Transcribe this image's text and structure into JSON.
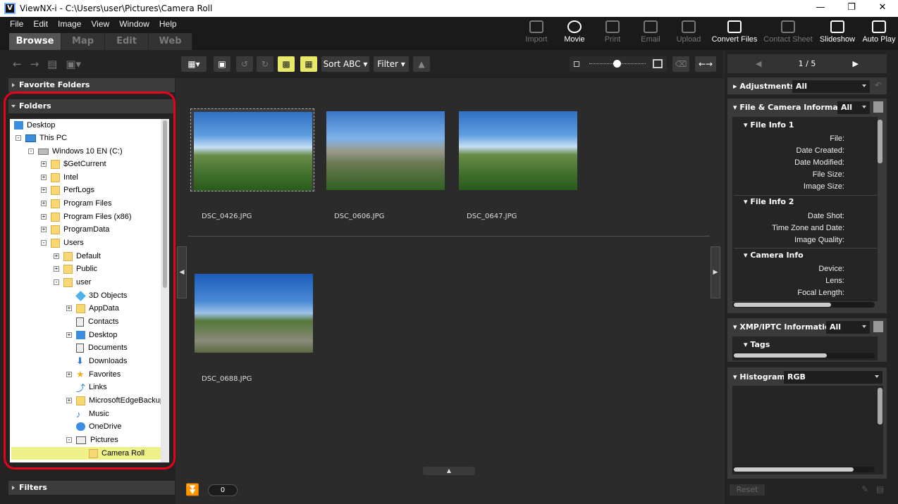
{
  "titlebar": {
    "app_name": "ViewNX-i",
    "path": "C:\\Users\\user\\Pictures\\Camera Roll",
    "logo_text": "V"
  },
  "menu": [
    "File",
    "Edit",
    "Image",
    "View",
    "Window",
    "Help"
  ],
  "mode_tabs": [
    "Browse",
    "Map",
    "Edit",
    "Web"
  ],
  "top_buttons": [
    "Import",
    "Movie",
    "Print",
    "Email",
    "Upload",
    "Convert Files",
    "Contact Sheet",
    "Slideshow",
    "Auto Play"
  ],
  "left": {
    "favorite_folders": "Favorite Folders",
    "folders": "Folders",
    "filters": "Filters",
    "tree": [
      "Desktop",
      "This PC",
      "Windows 10 EN (C:)",
      "$GetCurrent",
      "Intel",
      "PerfLogs",
      "Program Files",
      "Program Files (x86)",
      "ProgramData",
      "Users",
      "Default",
      "Public",
      "user",
      "3D Objects",
      "AppData",
      "Contacts",
      "Desktop",
      "Documents",
      "Downloads",
      "Favorites",
      "Links",
      "MicrosoftEdgeBackup",
      "Music",
      "OneDrive",
      "Pictures",
      "Camera Roll"
    ]
  },
  "center": {
    "sort_label": "Sort ABC",
    "filter_label": "Filter",
    "thumbnails": [
      "DSC_0426.JPG",
      "DSC_0606.JPG",
      "DSC_0647.JPG",
      "DSC_0688.JPG"
    ],
    "bottom_count": "0"
  },
  "right": {
    "pager": "1 / 5",
    "adjustments": "Adjustments",
    "adjustments_value": "All",
    "file_camera_info": "File & Camera Information",
    "file_camera_value": "All",
    "file_info_1": "File Info 1",
    "file_info_1_fields": [
      "File:",
      "Date Created:",
      "Date Modified:",
      "File Size:",
      "Image Size:"
    ],
    "file_info_2": "File Info 2",
    "file_info_2_fields": [
      "Date Shot:",
      "Time Zone and Date:",
      "Image Quality:"
    ],
    "camera_info": "Camera Info",
    "camera_info_fields": [
      "Device:",
      "Lens:",
      "Focal Length:"
    ],
    "xmp": "XMP/IPTC Information",
    "xmp_value": "All",
    "tags": "Tags",
    "histogram": "Histogram",
    "histogram_value": "RGB",
    "reset": "Reset"
  }
}
